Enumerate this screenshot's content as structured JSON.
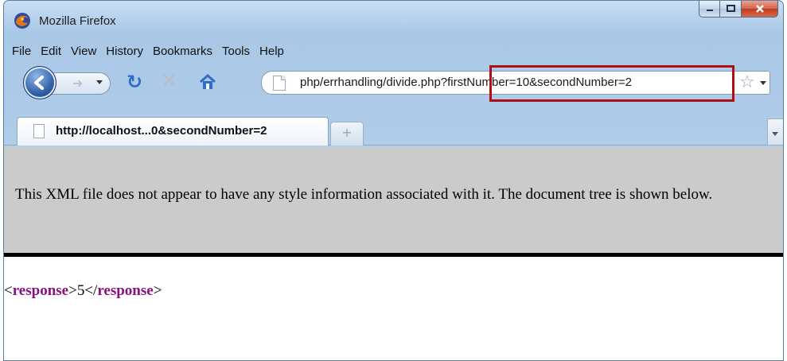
{
  "window": {
    "title": "Mozilla Firefox"
  },
  "menu": {
    "items": [
      {
        "label": "File"
      },
      {
        "label": "Edit"
      },
      {
        "label": "View"
      },
      {
        "label": "History"
      },
      {
        "label": "Bookmarks"
      },
      {
        "label": "Tools"
      },
      {
        "label": "Help"
      }
    ]
  },
  "navbar": {
    "url": "php/errhandling/divide.php?firstNumber=10&secondNumber=2",
    "icons": [
      "back-icon",
      "forward-icon",
      "reload-icon",
      "stop-icon",
      "home-icon",
      "bookmark-star-icon"
    ]
  },
  "tab": {
    "label": "http://localhost...0&secondNumber=2",
    "new_tab_glyph": "+"
  },
  "document": {
    "notice": "This XML file does not appear to have any style information associated with it. The document tree is shown below.",
    "open_bracket": "<",
    "tag": "response",
    "close_bracket": ">",
    "value": "5",
    "end_open": "</",
    "end_tag": "response",
    "end_close": ">"
  },
  "colors": {
    "highlight": "#b00f12",
    "xml_tag": "#881280",
    "info_bg": "#cbcbcb"
  }
}
